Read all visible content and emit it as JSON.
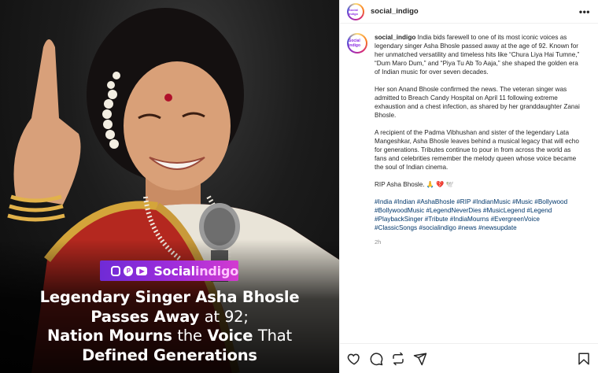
{
  "post_image": {
    "brand_prefix": "Social",
    "brand_suffix": "indigo",
    "headline": {
      "line1": "Legendary Singer Asha Bhosle",
      "line2_bold": "Passes Away",
      "line2_light": "at 92;",
      "line3_bold1": "Nation Mourns",
      "line3_light1": "the",
      "line3_bold2": "Voice",
      "line3_light2": "That",
      "line4": "Defined Generations"
    }
  },
  "header": {
    "username": "social_indigo",
    "avatar_text": "Social indigo",
    "more_label": "•••"
  },
  "caption": {
    "username": "social_indigo",
    "paragraphs": [
      "India bids farewell to one of its most iconic voices as legendary singer Asha Bhosle passed away at the age of 92. Known for her unmatched versatility and timeless hits like “Chura Liya Hai Tumne,” “Dum Maro Dum,” and “Piya Tu Ab To Aaja,” she shaped the golden era of Indian music for over seven decades.",
      "Her son Anand Bhosle confirmed the news. The veteran singer was admitted to Breach Candy Hospital on April 11 following extreme exhaustion and a chest infection, as shared by her granddaughter Zanai Bhosle.",
      "A recipient of the Padma Vibhushan and sister of the legendary Lata Mangeshkar, Asha Bhosle leaves behind a musical legacy that will echo for generations. Tributes continue to pour in from across the world as fans and celebrities remember the melody queen whose voice became the soul of Indian cinema.",
      "RIP Asha Bhosle. 🙏 💔 🕊️"
    ],
    "hashtags": "#India #Indian #AshaBhosle #RIP #IndianMusic #Music #Bollywood #BollywoodMusic #LegendNeverDies #MusicLegend #Legend #PlaybackSinger #Tribute #IndiaMourns #EvergreenVoice #ClassicSongs #socialindigo #news #newsupdate",
    "time": "2h"
  },
  "colors": {
    "brand_gradient_start": "#6f2bd6",
    "brand_gradient_end": "#d33bd0",
    "hashtag": "#00376b",
    "muted": "#8e8e8e"
  },
  "icons": [
    "heart-icon",
    "comment-icon",
    "repost-icon",
    "share-icon",
    "bookmark-icon",
    "more-icon"
  ]
}
